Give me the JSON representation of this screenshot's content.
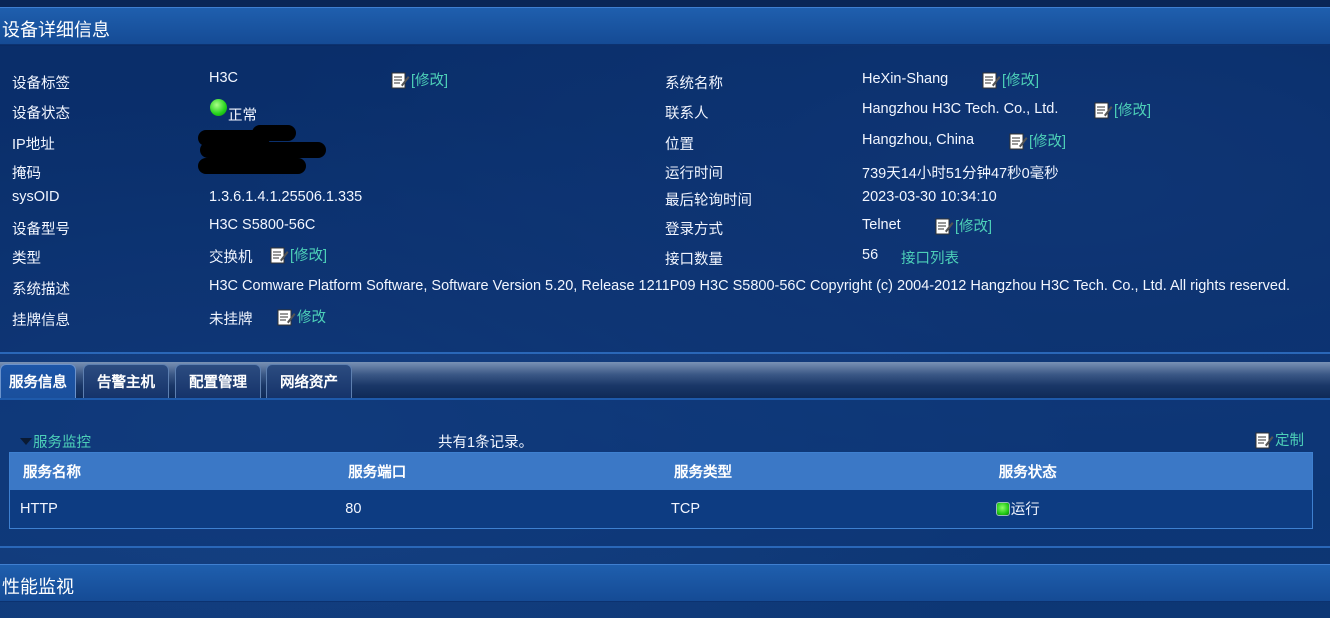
{
  "detail_section": {
    "title": "设备详细信息",
    "left": [
      {
        "label": "设备标签",
        "value": "H3C",
        "edit": "[修改]"
      },
      {
        "label": "设备状态",
        "value": "正常"
      },
      {
        "label": "IP地址",
        "value": ""
      },
      {
        "label": "掩码",
        "value": ""
      },
      {
        "label": "sysOID",
        "value": "1.3.6.1.4.1.25506.1.335"
      },
      {
        "label": "设备型号",
        "value": "H3C S5800-56C"
      },
      {
        "label": "类型",
        "value": "交换机",
        "edit": "[修改]"
      },
      {
        "label": "系统描述",
        "value": "H3C Comware Platform Software, Software Version 5.20, Release 1211P09 H3C S5800-56C Copyright (c) 2004-2012 Hangzhou H3C Tech. Co., Ltd. All rights reserved."
      },
      {
        "label": "挂牌信息",
        "value": "未挂牌",
        "edit": "修改"
      }
    ],
    "right": [
      {
        "label": "系统名称",
        "value": "HeXin-Shang",
        "edit": "[修改]"
      },
      {
        "label": "联系人",
        "value": "Hangzhou H3C Tech. Co., Ltd.",
        "edit": "[修改]"
      },
      {
        "label": "位置",
        "value": "Hangzhou, China",
        "edit": "[修改]"
      },
      {
        "label": "运行时间",
        "value": "739天14小时51分钟47秒0毫秒"
      },
      {
        "label": "最后轮询时间",
        "value": "2023-03-30 10:34:10"
      },
      {
        "label": "登录方式",
        "value": "Telnet",
        "edit": "[修改]"
      },
      {
        "label": "接口数量",
        "value": "56",
        "link": "接口列表"
      }
    ]
  },
  "tabs": [
    {
      "label": "服务信息",
      "active": true
    },
    {
      "label": "告警主机",
      "active": false
    },
    {
      "label": "配置管理",
      "active": false
    },
    {
      "label": "网络资产",
      "active": false
    }
  ],
  "service_panel": {
    "toggle_label": "服务监控",
    "record_count": "共有1条记录。",
    "custom_label": "定制",
    "columns": [
      "服务名称",
      "服务端口",
      "服务类型",
      "服务状态"
    ],
    "rows": [
      {
        "name": "HTTP",
        "port": "80",
        "type": "TCP",
        "status": "运行"
      }
    ]
  },
  "perf_section": {
    "title": "性能监视"
  },
  "icons": {
    "edit": "edit-note-icon",
    "status_ok": "green-status-dot-icon",
    "collapse": "triangle-down-icon"
  },
  "colors": {
    "background": "#0b2f6a",
    "header": "#1f5fae",
    "link": "#4dd0b8",
    "table_header": "#3b78c6",
    "status_green": "#22d11a"
  }
}
